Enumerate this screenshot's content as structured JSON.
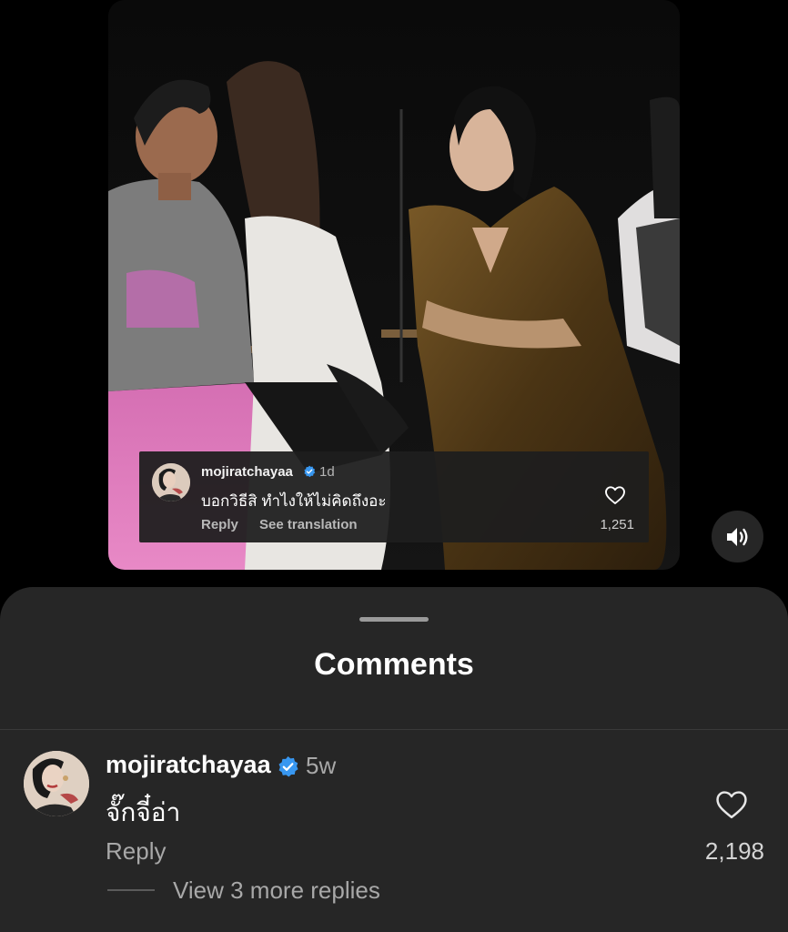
{
  "colors": {
    "background": "#000000",
    "sheet": "#262626",
    "verified": "#3897f0",
    "muted_text": "#a8a8a8"
  },
  "video": {
    "overlay_comment": {
      "username": "mojiratchayaa",
      "verified_icon": "verified-badge-icon",
      "time": "1d",
      "text": "บอกวิธีสิ ทำไงให้ไม่คิดถึงอะ",
      "reply_label": "Reply",
      "translate_label": "See translation",
      "likes": "1,251",
      "like_icon": "heart-outline-icon"
    },
    "sound_icon": "speaker-sound-on-icon"
  },
  "sheet": {
    "title": "Comments",
    "comment": {
      "username": "mojiratchayaa",
      "verified_icon": "verified-badge-icon",
      "time": "5w",
      "text": "จั๊กจี๋อ่า",
      "reply_label": "Reply",
      "likes": "2,198",
      "like_icon": "heart-outline-icon",
      "view_replies_label": "View 3 more replies"
    }
  }
}
